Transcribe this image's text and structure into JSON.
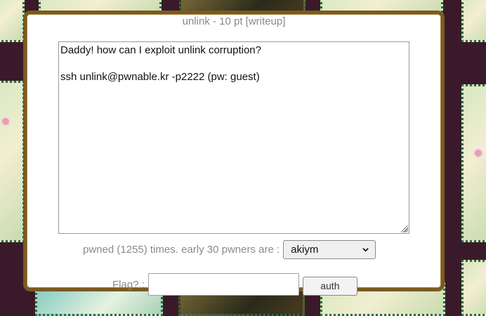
{
  "challenge": {
    "title": "unlink - 10 pt [writeup]",
    "description": "Daddy! how can I exploit unlink corruption?\n\nssh unlink@pwnable.kr -p2222 (pw: guest)"
  },
  "pwners": {
    "label": "pwned (1255) times. early 30 pwners are :",
    "selected": "akiym"
  },
  "flag": {
    "label": "Flag? :",
    "value": "",
    "submit_label": "auth"
  }
}
